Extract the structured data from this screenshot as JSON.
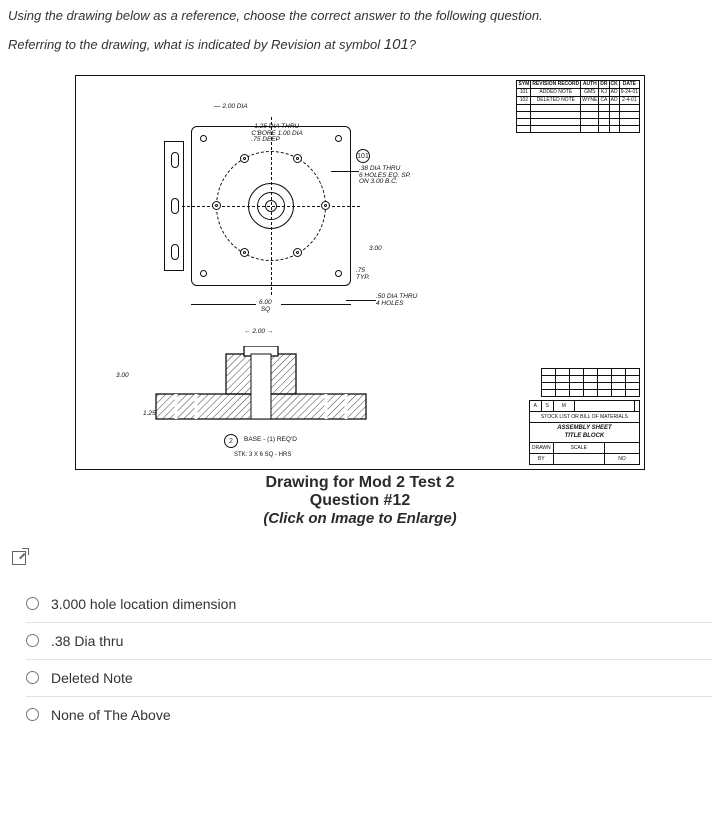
{
  "prompt": "Using the drawing below as a  reference, choose the correct answer to the following question.",
  "question_prefix": "Referring to the drawing, what is indicated by Revision at symbol ",
  "question_symbol": "101",
  "question_suffix": "?",
  "revision_block": {
    "headers": [
      "SYM",
      "REVISION RECORD",
      "AUTH",
      "DR",
      "CK",
      "DATE"
    ],
    "rows": [
      {
        "sym": "101",
        "record": "ADDED NOTE",
        "auth": "GMS",
        "dr": "KJ",
        "ck": "AD",
        "date": "9-24-01"
      },
      {
        "sym": "102",
        "record": "DELETED NOTE",
        "auth": "WYNE",
        "dr": "CA",
        "ck": "AD",
        "date": "2-4-01"
      }
    ]
  },
  "title_block": {
    "stock_row": "STOCK LIST OR BILL OF MATERIALS",
    "title1": "ASSEMBLY SHEET",
    "title2": "TITLE BLOCK",
    "left_cells": [
      "A",
      "S",
      "M"
    ],
    "bottom": {
      "drawn": "DRAWN",
      "scale": "SCALE",
      "by": "BY",
      "no": "NO"
    }
  },
  "annotations": {
    "a1": "2.00 DIA",
    "a2_l1": "1.25 DIA  THRU",
    "a2_l2": "C'BORE 1.00 DIA",
    "a2_l3": ".75 DEEP",
    "a3_l1": ".38 DIA THRU",
    "a3_l2": "6 HOLES EQ. SP.",
    "a3_l3": "ON 3.00 B.C.",
    "a4_d": "3.00",
    "a4_t_l1": ".75",
    "a4_t_l2": "TYP.",
    "a5_l1": ".50 DIA THRU",
    "a5_l2": "4 HOLES",
    "dim6": "6.00",
    "dim_sq": "SQ",
    "dim200": "2.00",
    "dim300": "3.00",
    "dim125": "1.25",
    "base_note": "BASE - (1) REQ'D",
    "stk": "STK: 3 X 6 SQ - HRS",
    "balloon101": "101",
    "balloon2": "2"
  },
  "caption": {
    "line1": "Drawing for Mod 2 Test 2",
    "line2": "Question #12",
    "line3": "(Click on Image to Enlarge)"
  },
  "options": [
    "3.000 hole location dimension",
    ".38 Dia thru",
    "Deleted Note",
    "None of The Above"
  ]
}
